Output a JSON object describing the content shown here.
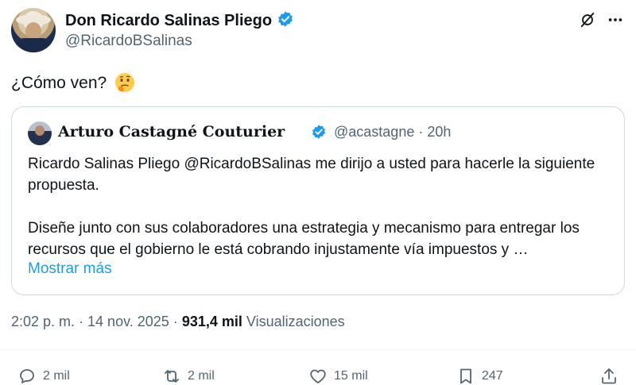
{
  "author": {
    "name": "Don Ricardo Salinas Pliego",
    "handle": "@RicardoBSalinas"
  },
  "tweet": {
    "text": "¿Cómo ven?",
    "emoji": "thinking-face"
  },
  "quote": {
    "author_name": "Arturo Castagné Couturier",
    "handle": "@acastagne",
    "time": "· 20h",
    "paragraph1": "Ricardo Salinas Pliego @RicardoBSalinas me dirijo a usted para hacerle la siguiente propuesta.",
    "paragraph2": "Diseñe junto con sus colaboradores una estrategia y mecanismo para entregar los recursos que el gobierno le está cobrando injustamente vía impuestos y …",
    "show_more": "Mostrar más"
  },
  "meta": {
    "timestamp": "2:02 p. m. · 14 nov. 2025 ·",
    "views_count": "931,4 mil",
    "views_label": "Visualizaciones"
  },
  "actions": {
    "replies": "2 mil",
    "reposts": "2 mil",
    "likes": "15 mil",
    "bookmarks": "247"
  },
  "colors": {
    "accent": "#1d9bf0",
    "verified": "#1d9bf0",
    "secondary_text": "#536471",
    "border": "#cfd9de"
  }
}
